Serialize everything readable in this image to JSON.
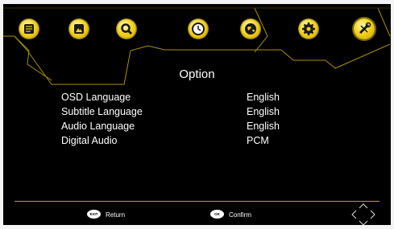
{
  "tabs": [
    {
      "name": "tab-channel",
      "icon": "list-icon"
    },
    {
      "name": "tab-picture",
      "icon": "picture-icon"
    },
    {
      "name": "tab-search",
      "icon": "search-icon"
    },
    {
      "name": "tab-time",
      "icon": "clock-icon"
    },
    {
      "name": "tab-lock",
      "icon": "globe-icon"
    },
    {
      "name": "tab-option",
      "icon": "gear-icon"
    },
    {
      "name": "tab-system",
      "icon": "tools-icon",
      "active": true
    }
  ],
  "menu": {
    "title": "Option",
    "items": [
      {
        "label": "OSD Language",
        "value": "English"
      },
      {
        "label": "Subtitle Language",
        "value": "English"
      },
      {
        "label": "Audio Language",
        "value": "English"
      },
      {
        "label": "Digital Audio",
        "value": "PCM"
      }
    ]
  },
  "footer": {
    "exit_chip": "EXIT",
    "return_label": "Return",
    "ok_chip": "OK",
    "confirm_label": "Confirm"
  },
  "colors": {
    "accent": "#f3d21b",
    "background": "#000000",
    "text": "#ffffff"
  }
}
